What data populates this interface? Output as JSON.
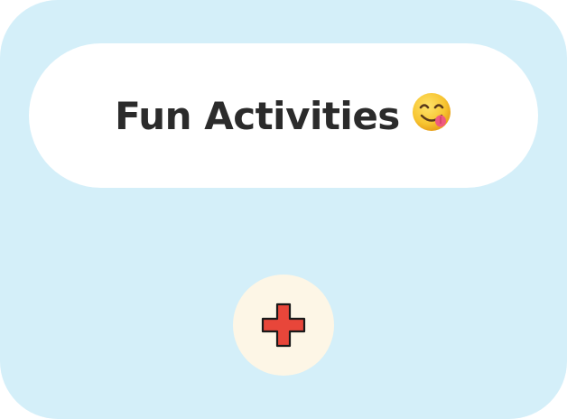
{
  "card": {
    "title": "Fun Activities",
    "title_emoji_icon": "yum-face-icon",
    "add_button_icon": "plus-icon"
  },
  "colors": {
    "card_background": "#d4eff9",
    "title_pill_background": "#ffffff",
    "title_text": "#2b2b2b",
    "add_button_background": "#fdf6e6",
    "plus_fill": "#e8463a",
    "plus_outline": "#1a1a1a",
    "emoji_face": "#f7c531",
    "emoji_tongue": "#ef5a7f"
  }
}
